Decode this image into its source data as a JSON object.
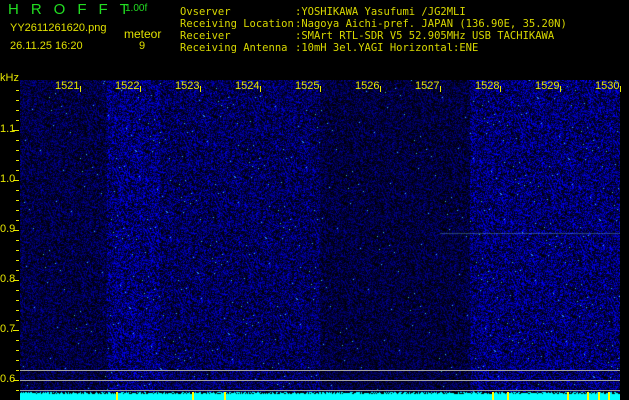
{
  "header": {
    "app_title": "HROFFT",
    "version": "1.00f",
    "filename": "YY2611261620.png",
    "datetime": "26.11.25 16:20",
    "detection_label": "meteor",
    "meteor_count": "9"
  },
  "info": [
    {
      "label": "Ovserver",
      "value": ":YOSHIKAWA Yasufumi /JG2MLI"
    },
    {
      "label": "Receiving Location",
      "value": ":Nagoya Aichi-pref. JAPAN (136.90E, 35.20N)"
    },
    {
      "label": "Receiver",
      "value": ":SMArt RTL-SDR V5 52.905MHz USB TACHIKAWA"
    },
    {
      "label": "Receiving Antenna",
      "value": ":10mH 3el.YAGI Horizontal:ENE"
    }
  ],
  "spectrogram": {
    "y_unit": "kHz",
    "y_ticks": [
      "1.1",
      "1.0",
      "0.9",
      "0.8",
      "0.7",
      "0.6"
    ],
    "minute_labels": [
      "1521",
      "1522",
      "1523",
      "1524",
      "1525",
      "1526",
      "1527",
      "1528",
      "1529",
      "1530"
    ],
    "colors": {
      "text": "#e8e800",
      "signal": "#0000ff",
      "level_bar": "#00ffff",
      "marker": "#ffff00"
    }
  }
}
